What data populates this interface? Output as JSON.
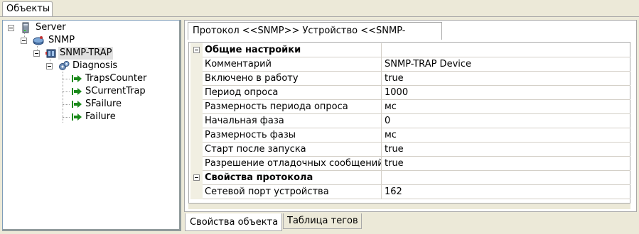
{
  "top_tab": {
    "label": "Объекты"
  },
  "tree": {
    "nodes": [
      {
        "label": "Server",
        "icon": "server-icon"
      },
      {
        "label": "SNMP",
        "icon": "snmp-icon"
      },
      {
        "label": "SNMP-TRAP",
        "icon": "device-icon",
        "selected": true
      },
      {
        "label": "Diagnosis",
        "icon": "gears-icon"
      },
      {
        "label": "TrapsCounter",
        "icon": "arrow-right-icon"
      },
      {
        "label": "SCurrentTrap",
        "icon": "arrow-right-icon"
      },
      {
        "label": "SFailure",
        "icon": "arrow-right-icon"
      },
      {
        "label": "Failure",
        "icon": "arrow-right-icon"
      }
    ]
  },
  "protocol_tab": {
    "label": "Протокол <<SNMP>> Устройство <<SNMP-TRAP>>"
  },
  "grid": {
    "general": {
      "title": "Общие настройки",
      "rows": [
        {
          "name": "Комментарий",
          "value": "SNMP-TRAP Device"
        },
        {
          "name": "Включено в работу",
          "value": "true"
        },
        {
          "name": "Период опроса",
          "value": "1000"
        },
        {
          "name": "Размерность периода опроса",
          "value": "мс"
        },
        {
          "name": "Начальная фаза",
          "value": "0"
        },
        {
          "name": "Размерность фазы",
          "value": "мс"
        },
        {
          "name": "Старт после запуска",
          "value": "true"
        },
        {
          "name": "Разрешение отладочных сообщений",
          "value": "true"
        }
      ]
    },
    "protocol": {
      "title": "Свойства протокола",
      "rows": [
        {
          "name": "Сетевой порт устройства",
          "value": "162"
        }
      ]
    }
  },
  "bottom_tabs": [
    {
      "label": "Свойства объекта",
      "active": true
    },
    {
      "label": "Таблица тегов",
      "active": false
    }
  ],
  "colors": {
    "accent_arrow": "#1a8a1a",
    "window_bg": "#ece9d8"
  }
}
